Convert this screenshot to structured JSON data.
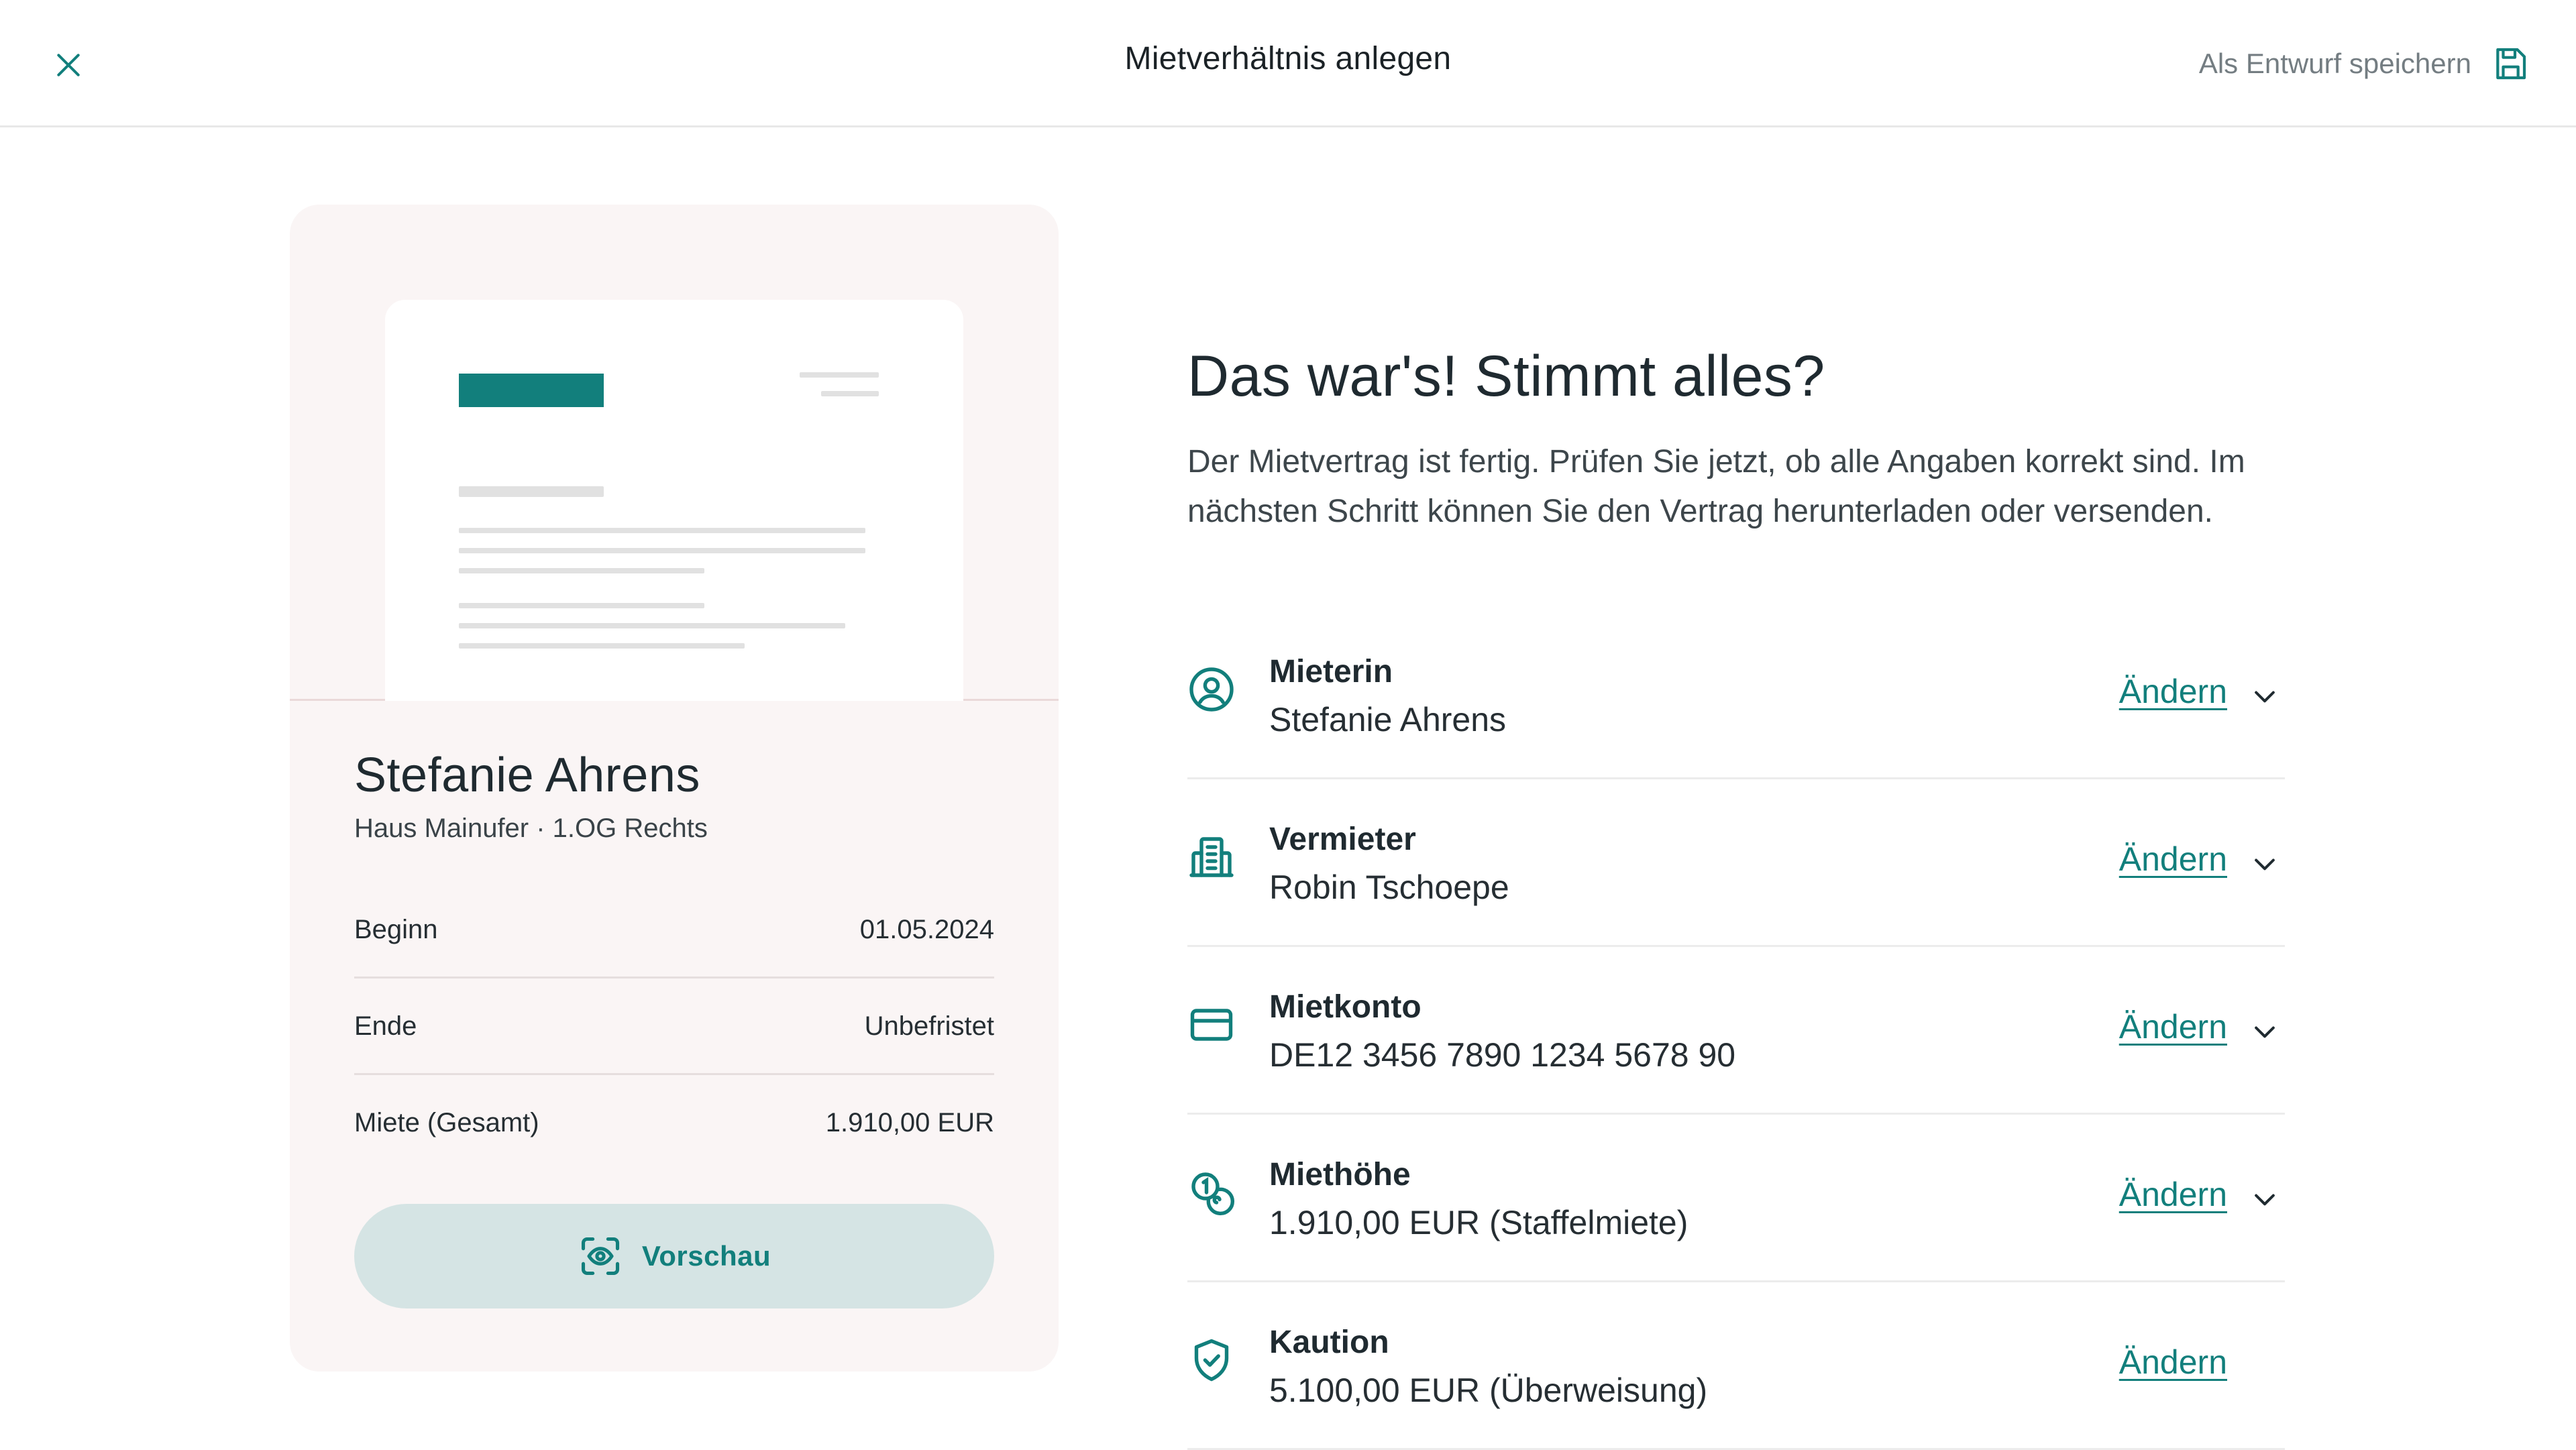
{
  "header": {
    "title": "Mietverhältnis anlegen",
    "draft_label": "Als Entwurf speichern"
  },
  "colors": {
    "accent": "#127f7c",
    "card_bg": "#faf5f5",
    "preview_button_bg": "#d5e4e4"
  },
  "card": {
    "tenant_name": "Stefanie Ahrens",
    "property": "Haus Mainufer · 1.OG Rechts",
    "details": [
      {
        "label": "Beginn",
        "value": "01.05.2024"
      },
      {
        "label": "Ende",
        "value": "Unbefristet"
      },
      {
        "label": "Miete (Gesamt)",
        "value": "1.910,00 EUR"
      }
    ],
    "preview_label": "Vorschau"
  },
  "summary": {
    "title": "Das war's! Stimmt alles?",
    "description": "Der Mietvertrag ist fertig. Prüfen Sie jetzt, ob alle Angaben korrekt sind. Im nächsten Schritt können Sie den Vertrag herunterladen oder versenden.",
    "sections": [
      {
        "label": "Mieterin",
        "value": "Stefanie Ahrens",
        "edit": "Ändern",
        "icon": "user-circle-icon",
        "expandable": true
      },
      {
        "label": "Vermieter",
        "value": "Robin Tschoepe",
        "edit": "Ändern",
        "icon": "building-icon",
        "expandable": true
      },
      {
        "label": "Mietkonto",
        "value": "DE12 3456 7890 1234 5678 90",
        "edit": "Ändern",
        "icon": "credit-card-icon",
        "expandable": true
      },
      {
        "label": "Miethöhe",
        "value": "1.910,00 EUR (Staffelmiete)",
        "edit": "Ändern",
        "icon": "coins-icon",
        "expandable": true
      },
      {
        "label": "Kaution",
        "value": "5.100,00 EUR (Überweisung)",
        "edit": "Ändern",
        "icon": "shield-check-icon",
        "expandable": false
      }
    ]
  }
}
